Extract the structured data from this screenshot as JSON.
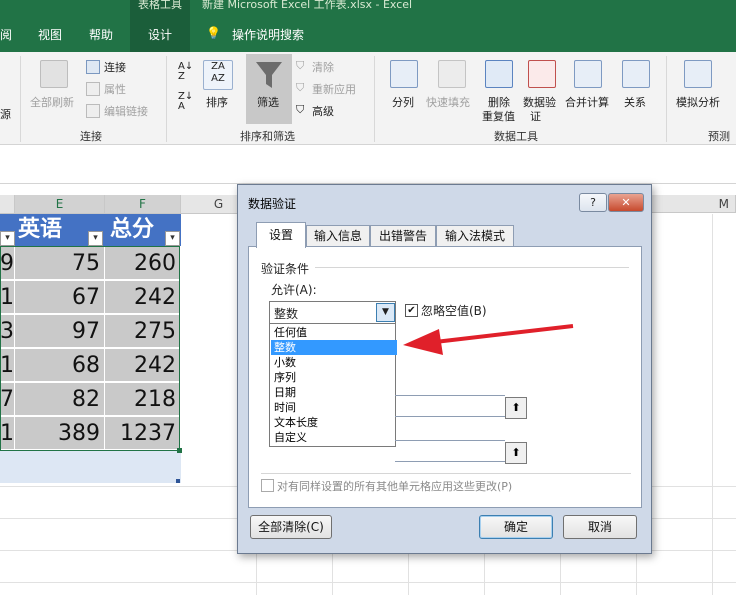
{
  "window": {
    "context_title": "表格工具",
    "doc_title": "新建 Microsoft Excel 工作表.xlsx  -  Excel"
  },
  "tabs": [
    "阅",
    "视图",
    "帮助",
    "设计"
  ],
  "tellme": "操作说明搜索",
  "ribbon": {
    "truncated_label": "源",
    "connections": {
      "refresh_all": "全部刷新",
      "connections": "连接",
      "properties": "属性",
      "edit_links": "编辑链接",
      "group": "连接"
    },
    "sort_filter": {
      "sort": "排序",
      "filter": "筛选",
      "clear": "清除",
      "reapply": "重新应用",
      "advanced": "高级",
      "group": "排序和筛选"
    },
    "data_tools": {
      "split": "分列",
      "flash_fill": "快速填充",
      "remove_dup_1": "删除",
      "remove_dup_2": "重复值",
      "validation_1": "数据验",
      "validation_2": "证",
      "consolidate": "合并计算",
      "relationships": "关系",
      "group": "数据工具"
    },
    "forecast": {
      "what_if": "模拟分析",
      "group": "预测"
    }
  },
  "sheet": {
    "columns": [
      "E",
      "F",
      "G",
      "M"
    ],
    "headers": [
      "英语",
      "总分"
    ],
    "row_stub": [
      "9",
      "1",
      "3",
      "1",
      "7",
      "1"
    ],
    "english": [
      "75",
      "67",
      "97",
      "68",
      "82",
      "389"
    ],
    "total": [
      "260",
      "242",
      "275",
      "242",
      "218",
      "1237"
    ]
  },
  "dialog": {
    "title": "数据验证",
    "help": "?",
    "close": "✕",
    "tabs": [
      "设置",
      "输入信息",
      "出错警告",
      "输入法模式"
    ],
    "section": "验证条件",
    "allow_label": "允许(A):",
    "allow_value": "整数",
    "ignore_blank": "忽略空值(B)",
    "options": [
      "任何值",
      "整数",
      "小数",
      "序列",
      "日期",
      "时间",
      "文本长度",
      "自定义"
    ],
    "apply_all": "对有同样设置的所有其他单元格应用这些更改(P)",
    "clear_all": "全部清除(C)",
    "ok": "确定",
    "cancel": "取消"
  },
  "colors": {
    "excel_green": "#217346",
    "table_header": "#4472c4",
    "highlight": "#3399ff",
    "arrow": "#e0202a"
  }
}
